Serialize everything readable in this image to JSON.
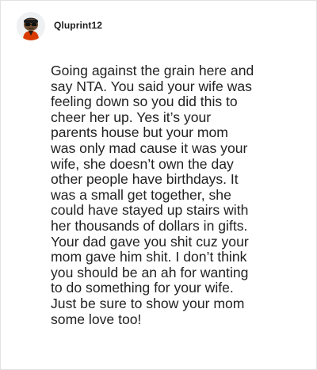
{
  "comment": {
    "username": "Qluprint12",
    "avatar_icon": "snoo-avatar-icon",
    "body": "Going against the grain here and\nsay NTA. You said your wife was\nfeeling down so you did this to\ncheer her up. Yes it’s your\nparents house but your mom\nwas only mad cause it was your\nwife, she doesn’t own the day\nother people have birthdays. It\nwas a small get together, she\ncould have stayed up stairs with\nher thousands of dollars in gifts.\nYour dad gave you shit cuz your\nmom gave him shit. I don’t think\nyou should be an ah for wanting\nto do something for your wife.\nJust be sure to show your mom\nsome love too!"
  },
  "colors": {
    "text": "#222222",
    "username": "#1c1c1c",
    "avatar_shirt": "#d93a00",
    "border": "#e2e2e2"
  }
}
